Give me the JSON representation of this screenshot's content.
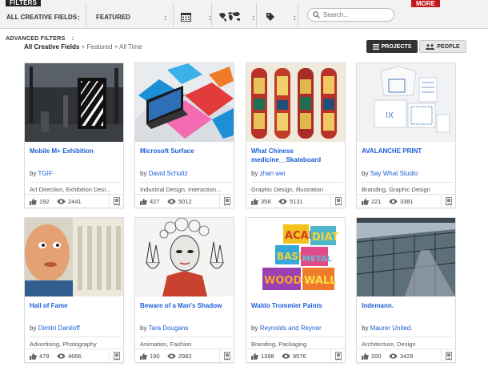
{
  "filters": {
    "tag": "FILTERS",
    "more": "MORE",
    "creative_fields": "ALL CREATIVE FIELDS",
    "sort": "FEATURED",
    "colon": ":",
    "search_placeholder": "Search..."
  },
  "advanced": {
    "title": "ADVANCED FILTERS",
    "colon": ":",
    "crumb_field": "All Creative Fields",
    "crumb_rest": " + Featured + All Time"
  },
  "toggle": {
    "projects": "PROJECTS",
    "people": "PEOPLE"
  },
  "by": "by",
  "cards": [
    {
      "title": "Mobile M+ Exhibition",
      "author": "TGIF",
      "fields": "Art Direction, Exhibition Desi...",
      "likes": "192",
      "views": "2441"
    },
    {
      "title": "Microsoft Surface",
      "author": "David Schultz",
      "fields": "Industrial Design, Interaction...",
      "likes": "427",
      "views": "5012"
    },
    {
      "title": "What Chinese medicine__Skateboard",
      "author": "zhan wei",
      "fields": "Graphic Design, Illustration",
      "likes": "358",
      "views": "5131"
    },
    {
      "title": "AVALANCHE PRINT",
      "author": "Say What Studio",
      "fields": "Branding, Graphic Design",
      "likes": "221",
      "views": "3381"
    },
    {
      "title": "Hall of Fame",
      "author": "Dimitri Daniloff",
      "fields": "Advertising, Photography",
      "likes": "479",
      "views": "4666"
    },
    {
      "title": "Beware of a Man's Shadow",
      "author": "Tara Dougans",
      "fields": "Animation, Fashion",
      "likes": "190",
      "views": "2982"
    },
    {
      "title": "Waldo Trommler Paints",
      "author": "Reynolds and Reyner",
      "fields": "Branding, Packaging",
      "likes": "1398",
      "views": "9576"
    },
    {
      "title": "Indemann.",
      "author": "Maurer United.",
      "fields": "Architecture, Design",
      "likes": "200",
      "views": "3429"
    }
  ],
  "paint_cans": {
    "line1": "ACAD",
    "line2": "DIAT",
    "line3": "BASE",
    "line4": "METAL",
    "line5": "WOOD",
    "line6": "WALL"
  }
}
